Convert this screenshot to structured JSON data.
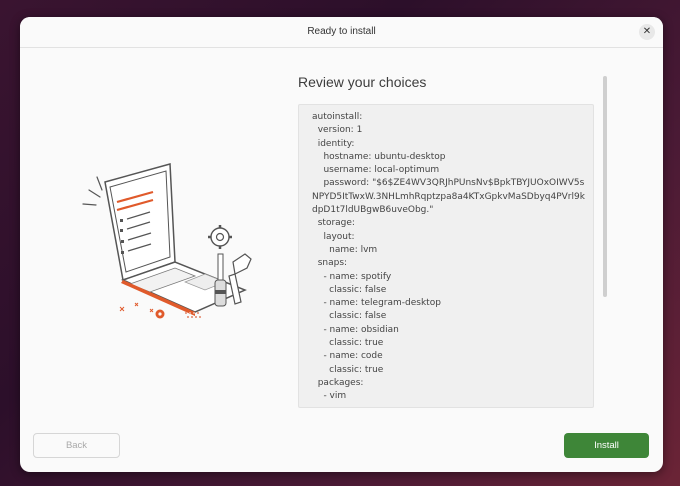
{
  "window": {
    "title": "Ready to install"
  },
  "main": {
    "heading": "Review your choices",
    "autoinstall_text": "autoinstall:\n  version: 1\n  identity:\n    hostname: ubuntu-desktop\n    username: local-optimum\n    password: \"$6$ZE4WV3QRJhPUnsNv$BpkTBYJUOxOIWV5s\nNPYD5ItTwxW.3NHLmhRqptzpa8a4KTxGpkvMaSDbyq4PVrl9k\ndpD1t7ldUBgwB6uveObg.\"\n  storage:\n    layout:\n      name: lvm\n  snaps:\n    - name: spotify\n      classic: false\n    - name: telegram-desktop\n      classic: false\n    - name: obsidian\n      classic: true\n    - name: code\n      classic: true\n  packages:\n    - vim"
  },
  "footer": {
    "back_label": "Back",
    "install_label": "Install"
  },
  "colors": {
    "accent_green": "#3e8638",
    "illustration_orange": "#e05a2b"
  },
  "icons": {
    "close": "close-icon",
    "illustration": "laptop-with-tools-illustration"
  }
}
